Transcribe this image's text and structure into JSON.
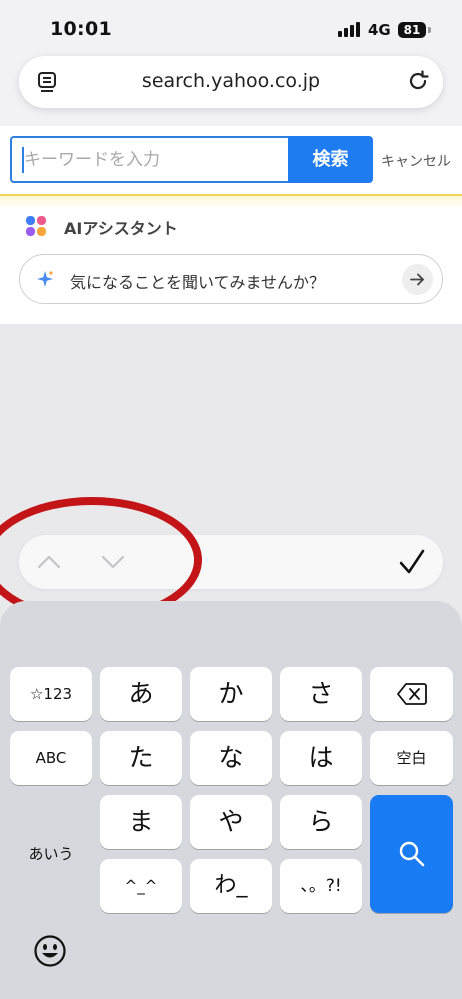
{
  "status_bar": {
    "time": "10:01",
    "network": "4G",
    "battery": "81"
  },
  "browser": {
    "url": "search.yahoo.co.jp",
    "icons": {
      "tabs": "tabs-icon",
      "reload": "reload-icon"
    }
  },
  "search": {
    "placeholder": "キーワードを入力",
    "button_label": "検索",
    "cancel_label": "キャンセル"
  },
  "ai_assistant": {
    "title": "AIアシスタント",
    "prompt": "気になることを聞いてみませんか？"
  },
  "accessory": {
    "icons": [
      "chevron-up-icon",
      "chevron-down-icon",
      "checkmark-icon"
    ]
  },
  "keyboard": {
    "keys": {
      "symbols": "☆123",
      "a": "あ",
      "ka": "か",
      "sa": "さ",
      "abc": "ABC",
      "ta": "た",
      "na": "な",
      "ha": "は",
      "space": "空白",
      "aiu": "あいう",
      "ma": "ま",
      "ya": "や",
      "ra": "ら",
      "kaomoji": "^_^",
      "wa": "わ_",
      "punct": "、。?!"
    },
    "icons": [
      "delete-icon",
      "search-icon",
      "emoji-icon"
    ]
  },
  "colors": {
    "accent": "#1f7cf0",
    "annotation": "#c31517"
  }
}
